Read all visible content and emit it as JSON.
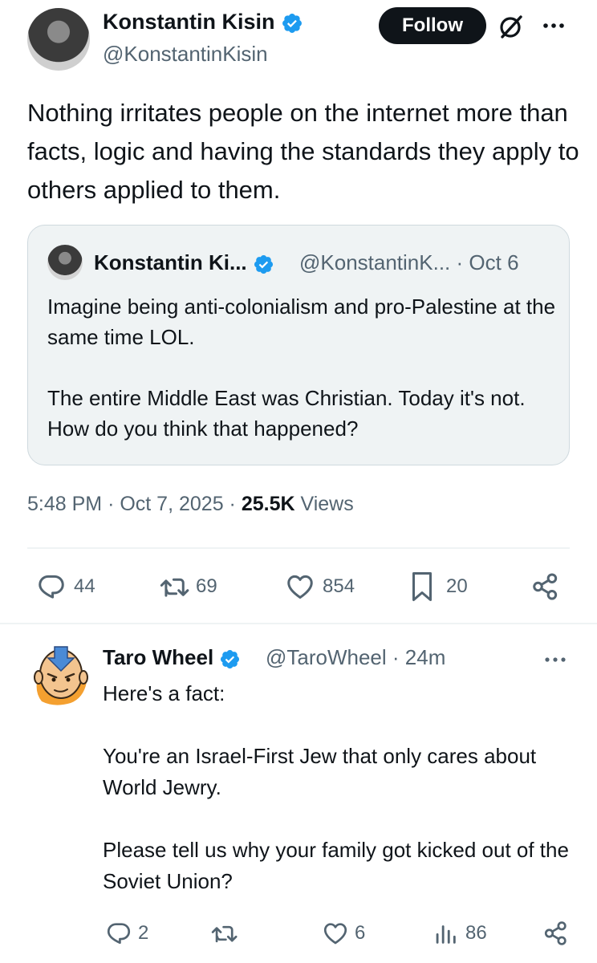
{
  "tweet": {
    "author_name": "Konstantin Kisin",
    "author_handle": "@KonstantinKisin",
    "follow_label": "Follow",
    "text": "Nothing irritates people on the internet more than facts, logic and having the standards they apply to others applied to them.",
    "time": "5:48 PM",
    "date": "Oct 7, 2025",
    "views_count": "25.5K",
    "views_label": "Views",
    "replies": "44",
    "reposts": "69",
    "likes": "854",
    "bookmarks": "20"
  },
  "quote": {
    "author_name": "Konstantin Ki...",
    "author_handle": "@KonstantinK...",
    "date": "Oct 6",
    "text_p1": "Imagine being anti-colonialism and pro-Palestine at the same time LOL.",
    "text_p2": "The entire Middle East was Christian. Today it's not. How do you think that happened?"
  },
  "reply": {
    "author_name": "Taro Wheel",
    "author_handle": "@TaroWheel",
    "age": "24m",
    "text": "Here's a fact:\n\nYou're an Israel-First Jew that only cares about World Jewry.\n\nPlease tell us why your family got kicked out of the Soviet Union?",
    "replies": "2",
    "likes": "6",
    "views": "86"
  },
  "colors": {
    "verified": "#1d9bf0",
    "text": "#0f1419",
    "secondary": "#536471",
    "quote_bg": "#eff3f4"
  },
  "icons": [
    "verified-badge",
    "grok-icon",
    "more-icon",
    "reply-icon",
    "repost-icon",
    "like-icon",
    "bookmark-icon",
    "share-icon",
    "views-icon"
  ]
}
